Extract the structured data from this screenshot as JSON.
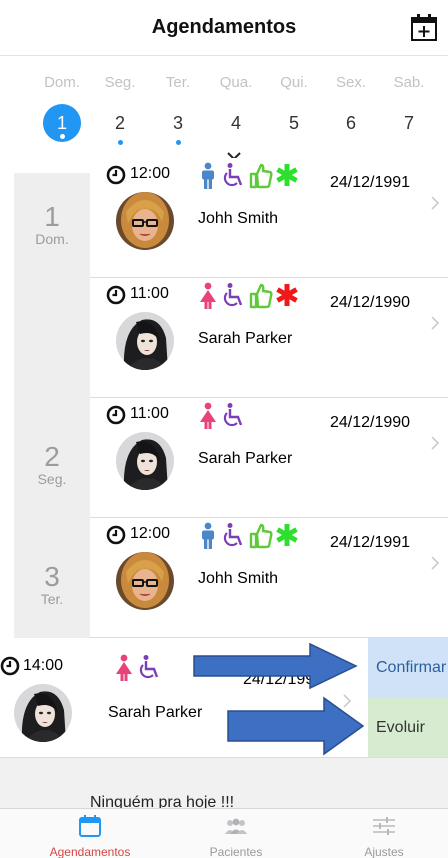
{
  "header": {
    "title": "Agendamentos"
  },
  "week": {
    "days": [
      {
        "name": "Dom.",
        "num": "1",
        "selected": true
      },
      {
        "name": "Seg.",
        "num": "2",
        "dot": true
      },
      {
        "name": "Ter.",
        "num": "3",
        "dot": true
      },
      {
        "name": "Qua.",
        "num": "4"
      },
      {
        "name": "Qui.",
        "num": "5"
      },
      {
        "name": "Sex.",
        "num": "6"
      },
      {
        "name": "Sab.",
        "num": "7"
      }
    ]
  },
  "date_groups": [
    {
      "num": "1",
      "name": "Dom."
    },
    {
      "num": "2",
      "name": "Seg."
    },
    {
      "num": "3",
      "name": "Ter."
    }
  ],
  "appointments": [
    {
      "time": "12:00",
      "name": "Johh Smith",
      "date": "24/12/1991",
      "icons": [
        "male-icon",
        "wheelchair-icon",
        "thumbs-up-icon",
        "asterisk-green-icon"
      ],
      "avatar": "blonde"
    },
    {
      "time": "11:00",
      "name": "Sarah Parker",
      "date": "24/12/1990",
      "icons": [
        "female-icon",
        "wheelchair-icon",
        "thumbs-up-icon",
        "asterisk-red-icon"
      ],
      "avatar": "dark"
    },
    {
      "time": "11:00",
      "name": "Sarah Parker",
      "date": "24/12/1990",
      "icons": [
        "female-icon",
        "wheelchair-icon"
      ],
      "avatar": "dark"
    },
    {
      "time": "12:00",
      "name": "Johh Smith",
      "date": "24/12/1991",
      "icons": [
        "male-icon",
        "wheelchair-icon",
        "thumbs-up-icon",
        "asterisk-green-icon"
      ],
      "avatar": "blonde"
    }
  ],
  "swiped": {
    "time": "14:00",
    "name": "Sarah Parker",
    "date": "24/12/1990",
    "icons": [
      "female-icon",
      "wheelchair-icon"
    ],
    "confirm_label": "Confirmar",
    "evolve_label": "Evoluir"
  },
  "empty_text": "Ninguém pra hoje !!!",
  "tabs": [
    {
      "label": "Agendamentos",
      "icon": "calendar-icon",
      "active": true
    },
    {
      "label": "Pacientes",
      "icon": "people-icon"
    },
    {
      "label": "Ajustes",
      "icon": "sliders-icon"
    }
  ],
  "colors": {
    "accent": "#2196f3",
    "male": "#4a86c8",
    "female": "#e8427a",
    "wheelchair": "#7b3fb8",
    "thumb": "#5fc93b",
    "asterisk_green": "#2ee02e",
    "asterisk_red": "#f01818",
    "tab_active": "#d64545",
    "arrow_fill": "#3d6fc2"
  }
}
